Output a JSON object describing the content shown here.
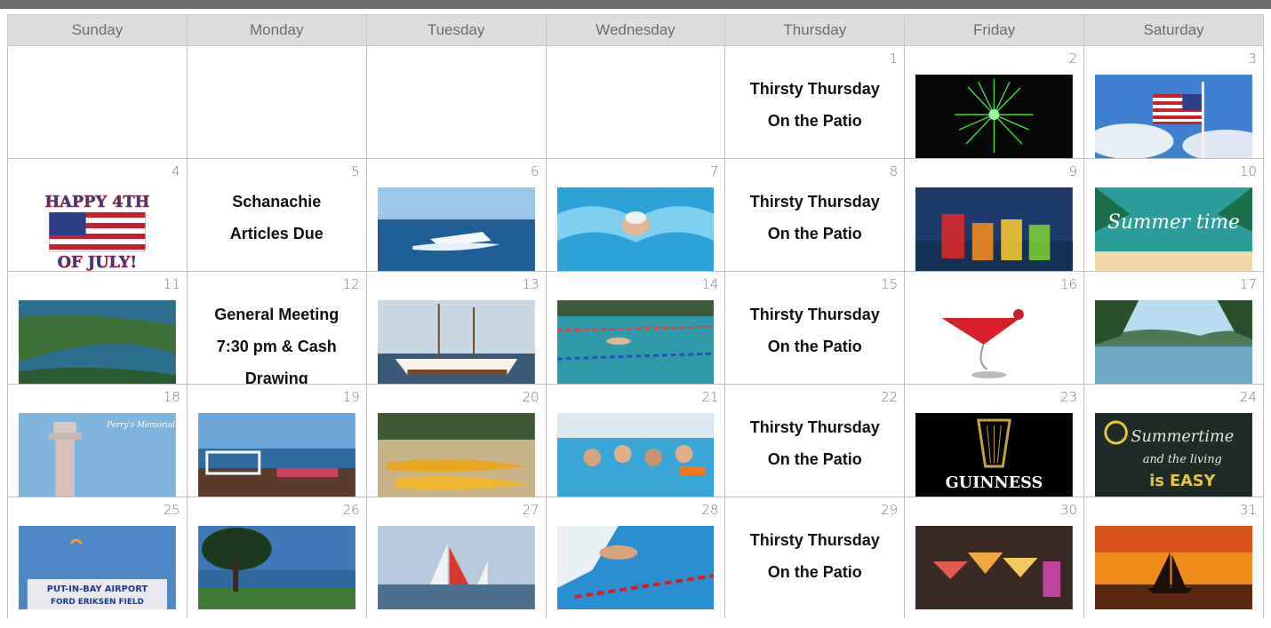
{
  "calendar": {
    "weekdays": [
      "Sunday",
      "Monday",
      "Tuesday",
      "Wednesday",
      "Thursday",
      "Friday",
      "Saturday"
    ],
    "days": {
      "d1": "1",
      "d2": "2",
      "d3": "3",
      "d4": "4",
      "d5": "5",
      "d6": "6",
      "d7": "7",
      "d8": "8",
      "d9": "9",
      "d10": "10",
      "d11": "11",
      "d12": "12",
      "d13": "13",
      "d14": "14",
      "d15": "15",
      "d16": "16",
      "d17": "17",
      "d18": "18",
      "d19": "19",
      "d20": "20",
      "d21": "21",
      "d22": "22",
      "d23": "23",
      "d24": "24",
      "d25": "25",
      "d26": "26",
      "d27": "27",
      "d28": "28",
      "d29": "29",
      "d30": "30",
      "d31": "31"
    },
    "events": {
      "thirsty_line1": "Thirsty Thursday",
      "thirsty_line2": "On the Patio",
      "schanachie_line1": "Schanachie",
      "schanachie_line2": "Articles Due",
      "meeting_line1": "General Meeting",
      "meeting_line2": "7:30 pm & Cash",
      "meeting_line3": "Drawing"
    },
    "image_text": {
      "july4_line1": "HAPPY 4TH",
      "july4_line2": "OF JULY!",
      "summertime": "Summer time",
      "guinness": "GUINNESS",
      "summer_easy_1": "Summertime",
      "summer_easy_2": "and the living",
      "summer_easy_3": "is EASY",
      "perry": "Perry's Memorial",
      "airport_1": "PUT-IN-BAY AIRPORT",
      "airport_2": "FORD ERIKSEN FIELD"
    }
  }
}
